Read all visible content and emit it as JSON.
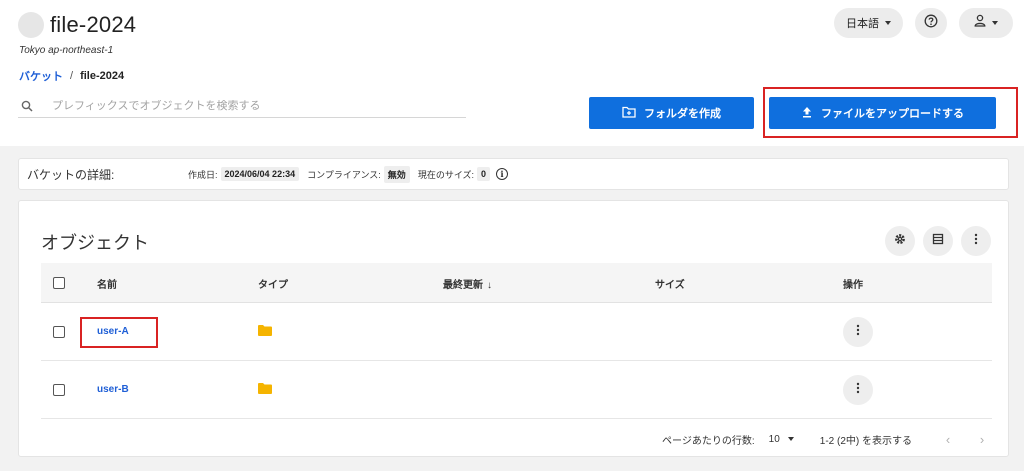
{
  "header": {
    "title": "file-2024",
    "region": "Tokyo ap-northeast-1",
    "language_label": "日本語"
  },
  "breadcrumb": {
    "root": "バケット",
    "separator": "/",
    "current": "file-2024"
  },
  "search": {
    "placeholder": "プレフィックスでオブジェクトを検索する"
  },
  "actions": {
    "create_folder": "フォルダを作成",
    "upload": "ファイルをアップロードする"
  },
  "details": {
    "title": "バケットの詳細:",
    "created_label": "作成日:",
    "created_value": "2024/06/04 22:34",
    "compliance_label": "コンプライアンス:",
    "compliance_value": "無効",
    "size_label": "現在のサイズ:",
    "size_value": "0"
  },
  "objects": {
    "title": "オブジェクト",
    "columns": {
      "name": "名前",
      "type": "タイプ",
      "modified": "最終更新",
      "size": "サイズ",
      "actions": "操作"
    },
    "rows": [
      {
        "name": "user-A"
      },
      {
        "name": "user-B"
      }
    ]
  },
  "pagination": {
    "rows_per_page_label": "ページあたりの行数:",
    "rows_per_page": "10",
    "range": "1-2 (2中) を表示する"
  },
  "colors": {
    "primary": "#0f6fde",
    "link": "#1f5fd6",
    "folder": "#f5b400",
    "highlight": "#d92323"
  },
  "icons": [
    "search-icon",
    "help-icon",
    "user-icon",
    "new-folder-icon",
    "upload-icon",
    "info-icon",
    "settings-icon",
    "columns-icon",
    "more-vert-icon",
    "folder-icon",
    "chevron-left-icon",
    "chevron-right-icon"
  ]
}
